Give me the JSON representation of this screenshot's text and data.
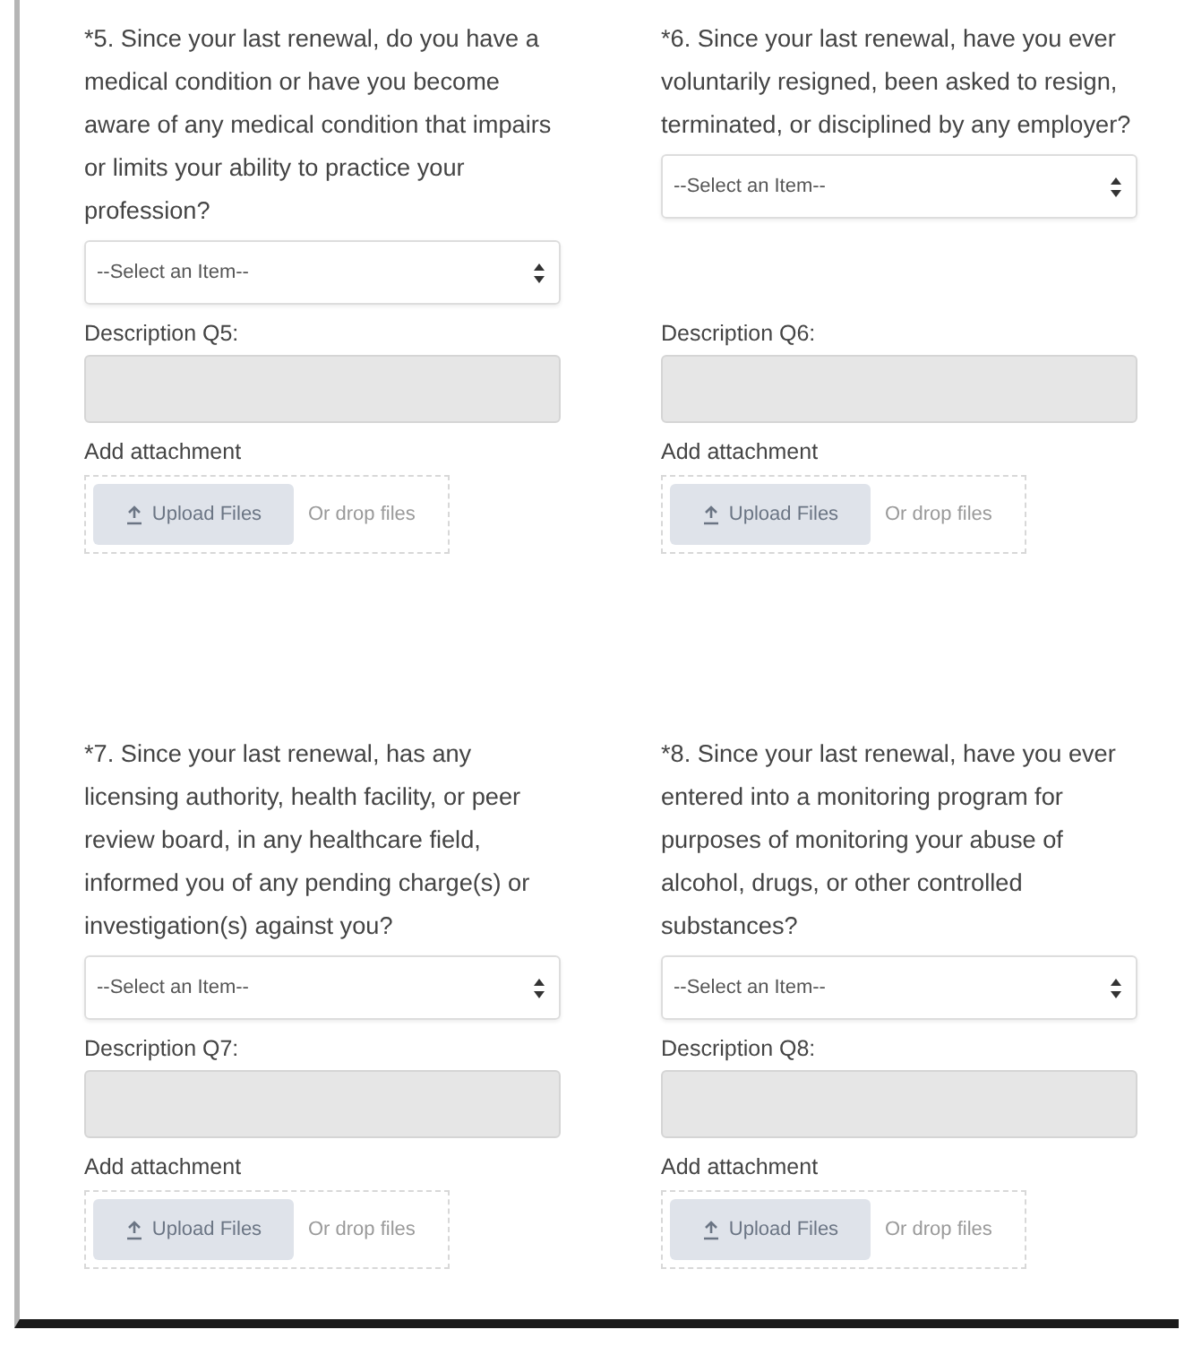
{
  "rows": [
    {
      "questions": [
        {
          "text": "*5. Since your last renewal, do you have a medical condition or have you become aware of any medical condition that impairs or limits your ability to practice your profession?",
          "select": "--Select an Item--",
          "description_label": "Description Q5:",
          "attachment_label": "Add attachment",
          "upload_button": "Upload Files",
          "drop_hint": "Or drop files",
          "description_disabled": true,
          "upload_disabled": true
        },
        {
          "text": "*6. Since your last renewal, have you ever voluntarily resigned, been asked to resign, terminated, or disciplined by any employer?",
          "select": "--Select an Item--",
          "description_label": "Description Q6:",
          "attachment_label": "Add attachment",
          "upload_button": "Upload Files",
          "drop_hint": "Or drop files",
          "description_disabled": true,
          "upload_disabled": true
        }
      ]
    },
    {
      "questions": [
        {
          "text": "*7. Since your last renewal, has any licensing authority, health facility, or peer review board, in any healthcare field, informed you of any pending charge(s) or investigation(s) against you?",
          "select": "--Select an Item--",
          "description_label": "Description Q7:",
          "attachment_label": "Add attachment",
          "upload_button": "Upload Files",
          "drop_hint": "Or drop files",
          "description_disabled": true,
          "upload_disabled": true
        },
        {
          "text": "*8. Since your last renewal, have you ever entered into a monitoring program for purposes of monitoring your abuse of alcohol, drugs, or other controlled substances?",
          "select": "--Select an Item--",
          "description_label": "Description Q8:",
          "attachment_label": "Add attachment",
          "upload_button": "Upload Files",
          "drop_hint": "Or drop files",
          "description_disabled": true,
          "upload_disabled": true
        }
      ]
    }
  ]
}
